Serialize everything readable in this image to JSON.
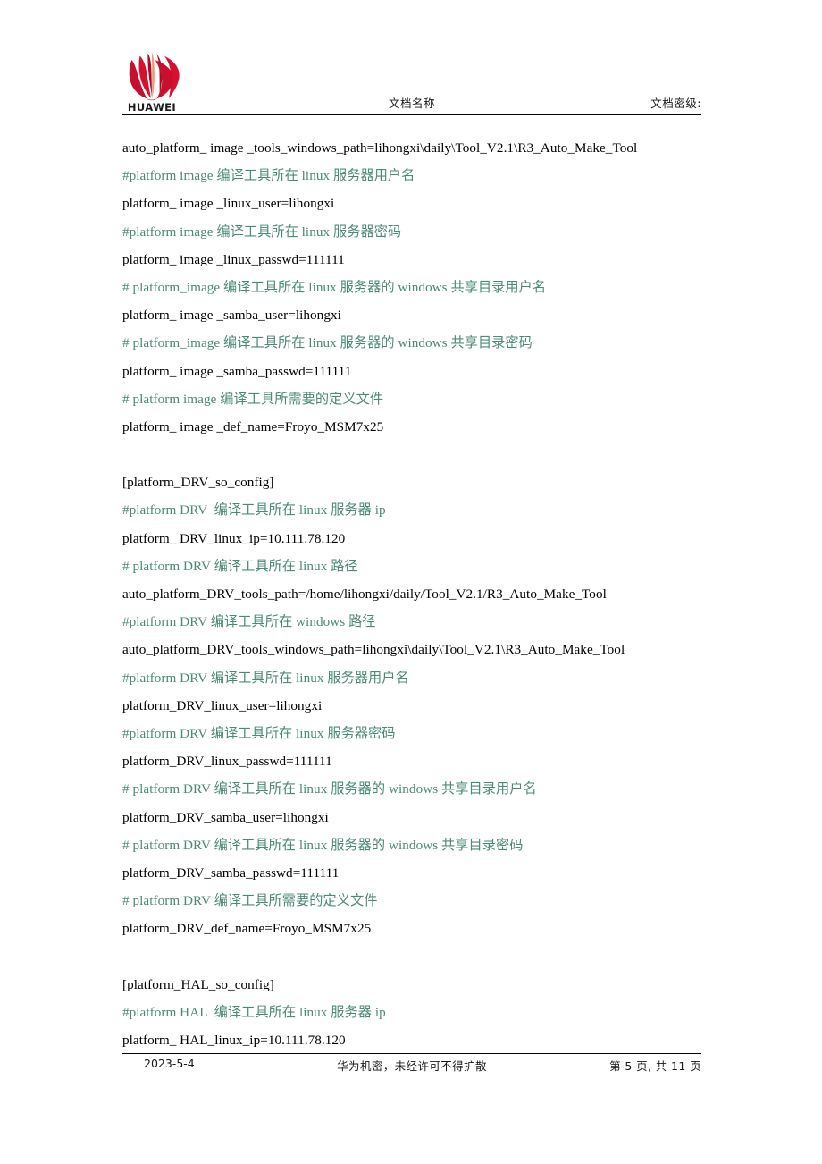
{
  "header": {
    "logo_alt": "HUAWEI",
    "logo_wordmark": "HUAWEI",
    "logo_color": "#cf0a2c",
    "center_title": "文档名称",
    "right_label": "文档密级:"
  },
  "document": {
    "comment_color": "#4b8a78",
    "body_color": "#000000",
    "lines": [
      {
        "type": "code",
        "text": "auto_platform_ image _tools_windows_path=lihongxi\\daily\\Tool_V2.1\\R3_Auto_Make_Tool"
      },
      {
        "type": "comment",
        "text": "#platform image 编译工具所在 linux 服务器用户名"
      },
      {
        "type": "code",
        "text": "platform_ image _linux_user=lihongxi"
      },
      {
        "type": "comment",
        "text": "#platform image 编译工具所在 linux 服务器密码"
      },
      {
        "type": "code",
        "text": "platform_ image _linux_passwd=111111"
      },
      {
        "type": "comment",
        "text": "# platform_image 编译工具所在 linux 服务器的 windows 共享目录用户名"
      },
      {
        "type": "code",
        "text": "platform_ image _samba_user=lihongxi"
      },
      {
        "type": "comment",
        "text": "# platform_image 编译工具所在 linux 服务器的 windows 共享目录密码"
      },
      {
        "type": "code",
        "text": "platform_ image _samba_passwd=111111"
      },
      {
        "type": "comment",
        "text": "# platform image 编译工具所需要的定义文件"
      },
      {
        "type": "code",
        "text": "platform_ image _def_name=Froyo_MSM7x25"
      },
      {
        "type": "blank",
        "text": ""
      },
      {
        "type": "code",
        "text": "[platform_DRV_so_config]"
      },
      {
        "type": "comment",
        "text": "#platform DRV  编译工具所在 linux 服务器 ip"
      },
      {
        "type": "code",
        "text": "platform_ DRV_linux_ip=10.111.78.120"
      },
      {
        "type": "comment",
        "text": "# platform DRV 编译工具所在 linux 路径"
      },
      {
        "type": "code",
        "text": "auto_platform_DRV_tools_path=/home/lihongxi/daily/Tool_V2.1/R3_Auto_Make_Tool"
      },
      {
        "type": "comment",
        "text": "#platform DRV 编译工具所在 windows 路径"
      },
      {
        "type": "code",
        "text": "auto_platform_DRV_tools_windows_path=lihongxi\\daily\\Tool_V2.1\\R3_Auto_Make_Tool"
      },
      {
        "type": "comment",
        "text": "#platform DRV 编译工具所在 linux 服务器用户名"
      },
      {
        "type": "code",
        "text": "platform_DRV_linux_user=lihongxi"
      },
      {
        "type": "comment",
        "text": "#platform DRV 编译工具所在 linux 服务器密码"
      },
      {
        "type": "code",
        "text": "platform_DRV_linux_passwd=111111"
      },
      {
        "type": "comment",
        "text": "# platform DRV 编译工具所在 linux 服务器的 windows 共享目录用户名"
      },
      {
        "type": "code",
        "text": "platform_DRV_samba_user=lihongxi"
      },
      {
        "type": "comment",
        "text": "# platform DRV 编译工具所在 linux 服务器的 windows 共享目录密码"
      },
      {
        "type": "code",
        "text": "platform_DRV_samba_passwd=111111"
      },
      {
        "type": "comment",
        "text": "# platform DRV 编译工具所需要的定义文件"
      },
      {
        "type": "code",
        "text": "platform_DRV_def_name=Froyo_MSM7x25"
      },
      {
        "type": "blank",
        "text": ""
      },
      {
        "type": "code",
        "text": "[platform_HAL_so_config]"
      },
      {
        "type": "comment",
        "text": "#platform HAL  编译工具所在 linux 服务器 ip"
      },
      {
        "type": "code",
        "text": "platform_ HAL_linux_ip=10.111.78.120"
      }
    ]
  },
  "footer": {
    "date": "2023-5-4",
    "confidentiality": "华为机密，未经许可不得扩散",
    "page_info": "第 5 页, 共 11 页"
  }
}
